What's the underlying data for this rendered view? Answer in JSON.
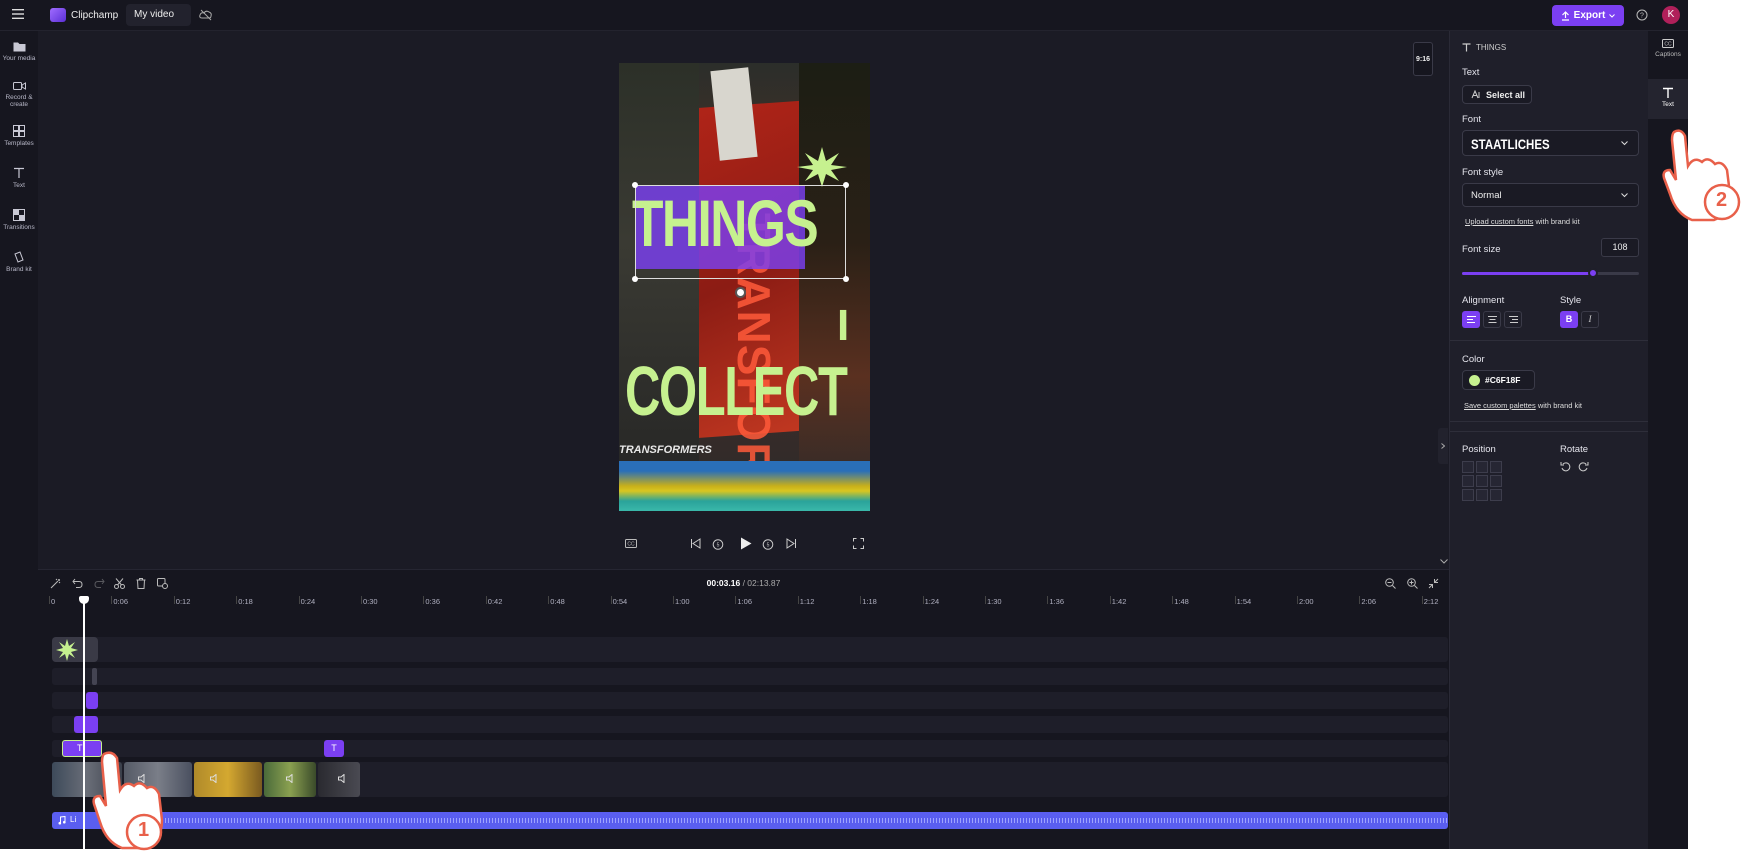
{
  "topbar": {
    "app_name": "Clipchamp",
    "project_name": "My video",
    "export_label": "Export",
    "avatar_initial": "K"
  },
  "leftnav": {
    "items": [
      {
        "label": "Your media",
        "icon": "folder-icon"
      },
      {
        "label": "Record & create",
        "icon": "camera-icon"
      },
      {
        "label": "Templates",
        "icon": "templates-icon"
      },
      {
        "label": "Text",
        "icon": "text-icon"
      },
      {
        "label": "Transitions",
        "icon": "transitions-icon"
      },
      {
        "label": "Brand kit",
        "icon": "brand-kit-icon"
      }
    ]
  },
  "preview": {
    "aspect_ratio": "9:16",
    "overlay_text_1": "THINGS",
    "overlay_text_2": "I",
    "overlay_text_3": "COLLECT",
    "poster_text": "TRANSFORMERS",
    "poster_vertical": "TRANSFORMERS",
    "text_color": "#C6F18F"
  },
  "timeline": {
    "current_time": "00:03.16",
    "total_time": "/ 02:13.87",
    "ticks": [
      "0",
      "0:06",
      "0:12",
      "0:18",
      "0:24",
      "0:30",
      "0:36",
      "0:42",
      "0:48",
      "0:54",
      "1:00",
      "1:06",
      "1:12",
      "1:18",
      "1:24",
      "1:30",
      "1:36",
      "1:42",
      "1:48",
      "1:54",
      "2:00",
      "2:06",
      "2:12"
    ],
    "audio_clip_label": "Li",
    "text_clip_icon": "T"
  },
  "rightpanel": {
    "header": "THINGS",
    "text_section": "Text",
    "select_all": "Select all",
    "font_label": "Font",
    "font_value": "STAATLICHES",
    "font_style_label": "Font style",
    "font_style_value": "Normal",
    "upload_link": "Upload custom fonts",
    "upload_suffix": "with brand kit",
    "font_size_label": "Font size",
    "font_size_value": "108",
    "font_size_fraction": 0.74,
    "alignment_label": "Alignment",
    "style_label": "Style",
    "bold_glyph": "B",
    "italic_glyph": "I",
    "color_label": "Color",
    "color_value": "#C6F18F",
    "save_link": "Save custom palettes",
    "save_suffix": "with brand kit",
    "position_label": "Position",
    "rotate_label": "Rotate"
  },
  "rightrail": {
    "captions_label": "Captions",
    "text_label": "Text"
  },
  "annotations": {
    "step1": "1",
    "step2": "2"
  },
  "colors": {
    "accent": "#7b3ff2",
    "text_green": "#C6F18F",
    "audio_track": "#5a5ef0"
  }
}
